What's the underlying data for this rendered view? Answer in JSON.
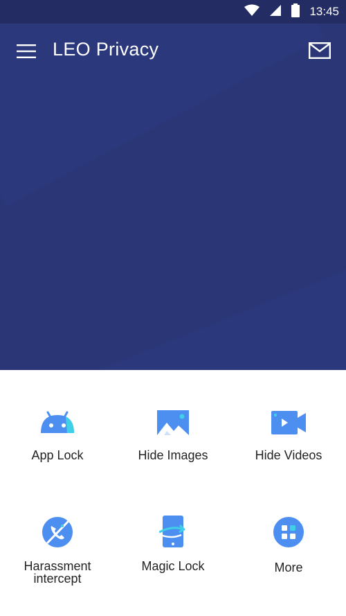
{
  "status_bar": {
    "time": "13:45",
    "icons": [
      "wifi-icon",
      "signal-icon",
      "battery-icon"
    ]
  },
  "app_bar": {
    "title": "LEO Privacy",
    "menu_icon": "hamburger-menu-icon",
    "mail_icon": "mail-icon"
  },
  "features": [
    {
      "label": "App Lock",
      "icon": "android-icon"
    },
    {
      "label": "Hide Images",
      "icon": "image-icon"
    },
    {
      "label": "Hide Videos",
      "icon": "video-icon"
    },
    {
      "label": "Harassment intercept",
      "icon": "blocked-call-icon"
    },
    {
      "label": "Magic Lock",
      "icon": "phone-swap-icon"
    },
    {
      "label": "More",
      "icon": "grid-more-icon"
    }
  ],
  "colors": {
    "hero_background": "#2a3676",
    "status_bar": "#232d64",
    "icon_blue": "#4d8ff0",
    "icon_accent": "#3fd0e8",
    "label_text": "#222222"
  }
}
